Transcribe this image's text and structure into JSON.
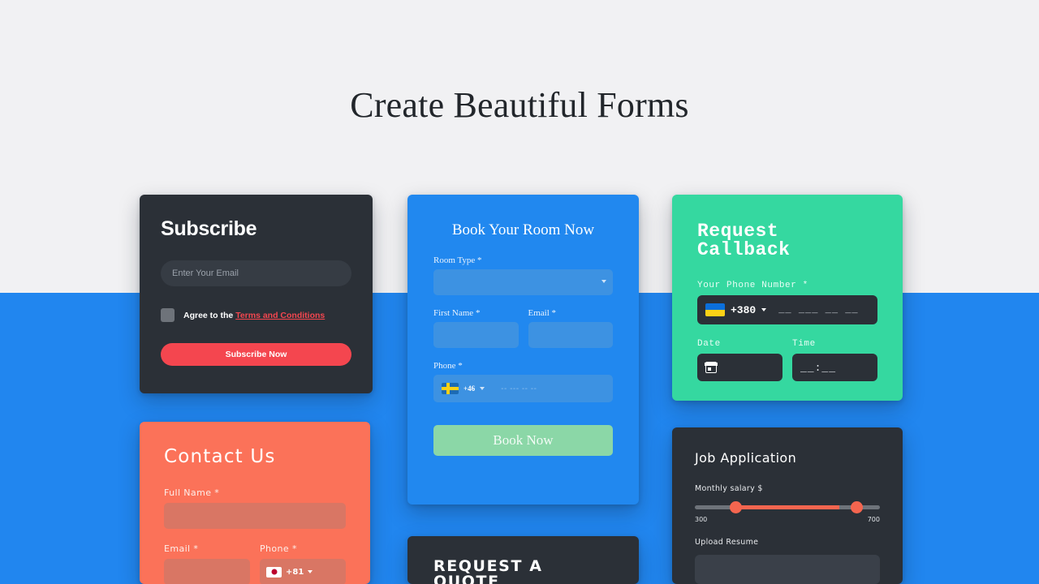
{
  "page": {
    "title": "Create Beautiful Forms",
    "bg_top_color": "#f1f1f3",
    "bg_bottom_color": "#2186ef"
  },
  "subscribe": {
    "title": "Subscribe",
    "email_placeholder": "Enter Your Email",
    "agree_text": "Agree to the ",
    "terms_link": "Terms and Conditions",
    "button_label": "Subscribe Now",
    "accent_color": "#f4464f",
    "card_color": "#2b3037"
  },
  "book": {
    "title": "Book Your Room Now",
    "room_type_label": "Room Type *",
    "room_type_value": "",
    "first_name_label": "First Name *",
    "first_name_value": "",
    "email_label": "Email *",
    "email_value": "",
    "phone_label": "Phone *",
    "phone_flag": "flag-sweden-icon",
    "phone_code": "+46",
    "phone_placeholder": "-- --- -- --",
    "button_label": "Book Now",
    "card_color": "#2188ef",
    "button_color": "#8bd7a7"
  },
  "callback": {
    "title": "Request Callback",
    "phone_label": "Your Phone Number *",
    "phone_flag": "flag-ukraine-icon",
    "phone_code": "+380",
    "phone_placeholder": "__ ___ __ __",
    "date_label": "Date",
    "date_value": "",
    "time_label": "Time",
    "time_value": "__:__",
    "card_color": "#35d8a0",
    "input_color": "#2b3037"
  },
  "contact": {
    "title": "Contact Us",
    "full_name_label": "Full Name *",
    "full_name_value": "",
    "email_label": "Email *",
    "email_value": "",
    "phone_label": "Phone *",
    "phone_flag": "flag-japan-icon",
    "phone_code": "+81",
    "card_color": "#fb7259"
  },
  "quote": {
    "title": "REQUEST A QUOTE",
    "card_color": "#2b3037"
  },
  "job": {
    "title": "Job Application",
    "salary_label": "Monthly salary $",
    "salary_min": "300",
    "salary_max": "700",
    "upload_label": "Upload Resume",
    "card_color": "#2b3037",
    "slider_color": "#f4654f"
  }
}
